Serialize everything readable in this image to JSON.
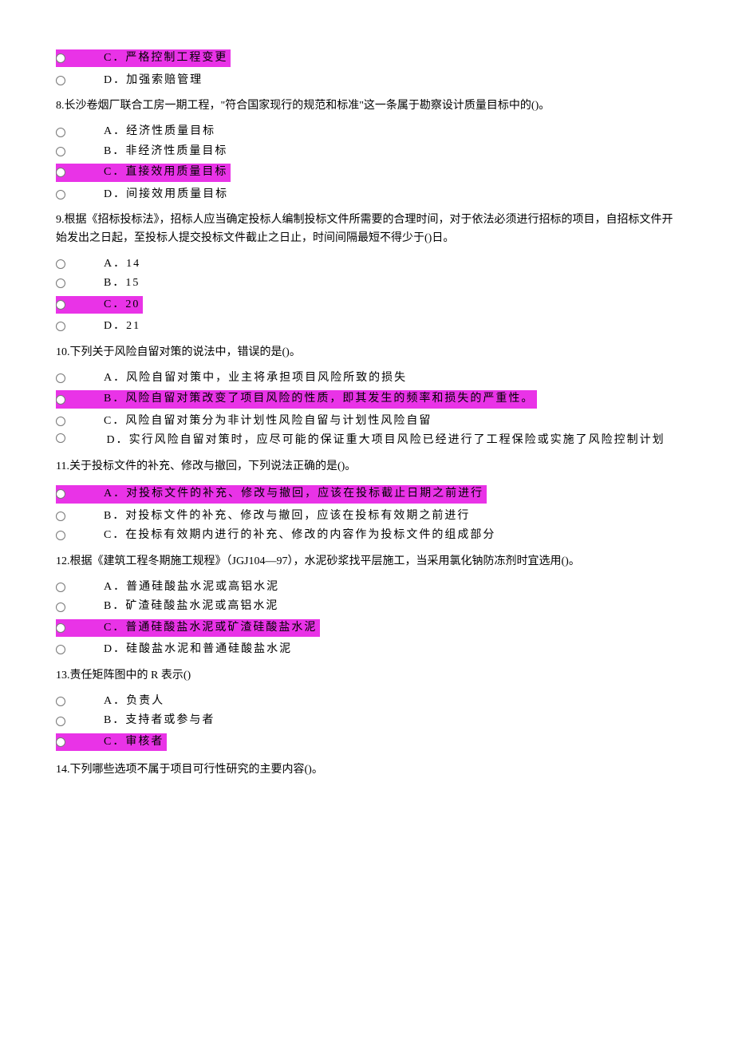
{
  "q7": {
    "opts": {
      "C": "C．严格控制工程变更",
      "D": "D．加强索赔管理"
    }
  },
  "q8": {
    "text": "8.长沙卷烟厂联合工房一期工程，\"符合国家现行的规范和标准\"这一条属于勘察设计质量目标中的()。",
    "opts": {
      "A": "A．经济性质量目标",
      "B": "B．非经济性质量目标",
      "C": "C．直接效用质量目标",
      "D": "D．间接效用质量目标"
    }
  },
  "q9": {
    "text": "9.根据《招标投标法》，招标人应当确定投标人编制投标文件所需要的合理时间，对于依法必须进行招标的项目，自招标文件开始发出之日起，至投标人提交投标文件截止之日止，时间间隔最短不得少于()日。",
    "opts": {
      "A": "A．14",
      "B": "B．15",
      "C": "C．20",
      "D": "D．21"
    }
  },
  "q10": {
    "text": "10.下列关于风险自留对策的说法中，错误的是()。",
    "opts": {
      "A": "A．风险自留对策中，业主将承担项目风险所致的损失",
      "B": "B．风险自留对策改变了项目风险的性质，即其发生的频率和损失的严重性。",
      "C": "C．风险自留对策分为非计划性风险自留与计划性风险自留",
      "D": "D．实行风险自留对策时，应尽可能的保证重大项目风险已经进行了工程保险或实施了风险控制计划"
    }
  },
  "q11": {
    "text": "11.关于投标文件的补充、修改与撤回，下列说法正确的是()。",
    "opts": {
      "A": "A．对投标文件的补充、修改与撤回，应该在投标截止日期之前进行",
      "B": "B．对投标文件的补充、修改与撤回，应该在投标有效期之前进行",
      "C": "C．在投标有效期内进行的补充、修改的内容作为投标文件的组成部分"
    }
  },
  "q12": {
    "text": "12.根据《建筑工程冬期施工规程》（JGJ104—97），水泥砂浆找平层施工，当采用氯化钠防冻剂时宜选用()。",
    "opts": {
      "A": "A．普通硅酸盐水泥或高铝水泥",
      "B": "B．矿渣硅酸盐水泥或高铝水泥",
      "C": "C．普通硅酸盐水泥或矿渣硅酸盐水泥",
      "D": "D．硅酸盐水泥和普通硅酸盐水泥"
    }
  },
  "q13": {
    "text": "13.责任矩阵图中的 R 表示()",
    "opts": {
      "A": "A．负责人",
      "B": "B．支持者或参与者",
      "C": "C．审核者"
    }
  },
  "q14": {
    "text": "14.下列哪些选项不属于项目可行性研究的主要内容()。"
  }
}
